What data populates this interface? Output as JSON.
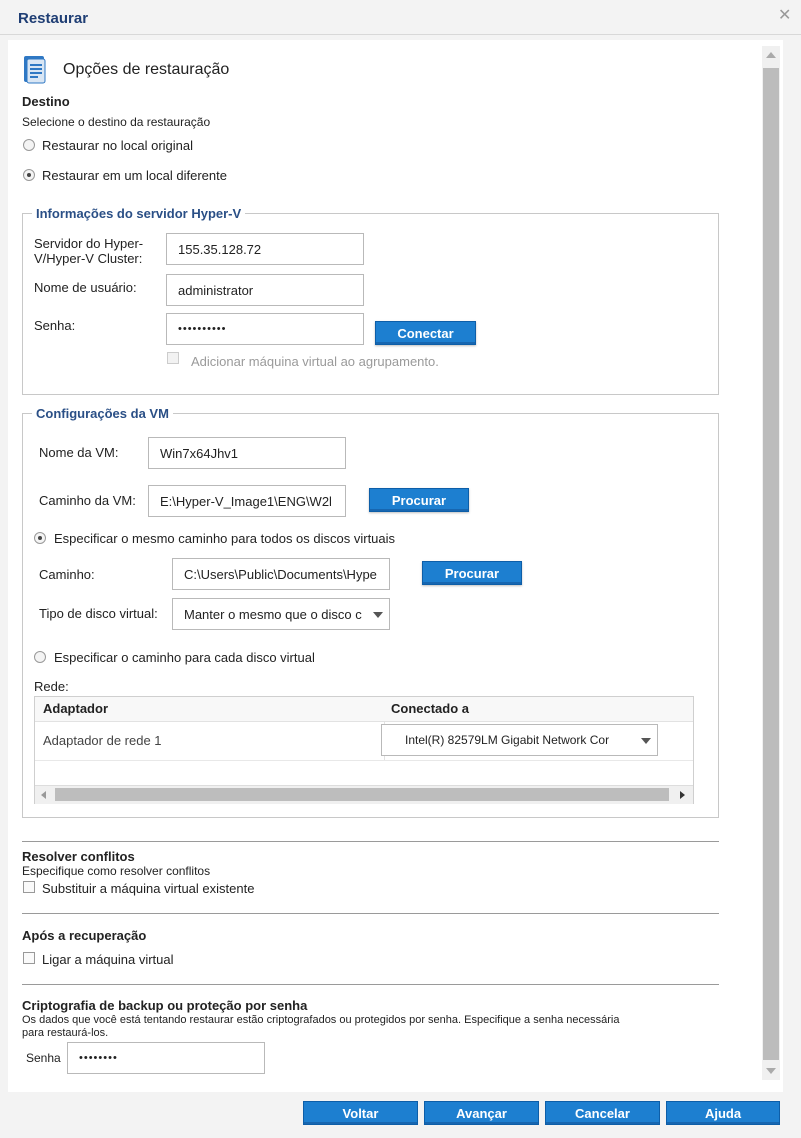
{
  "window": {
    "title": "Restaurar"
  },
  "header": {
    "title": "Opções de restauração"
  },
  "destination": {
    "heading": "Destino",
    "subtitle": "Selecione o destino da restauração",
    "option_original": "Restaurar no local original",
    "option_different": "Restaurar em um local diferente"
  },
  "hyperv": {
    "legend": "Informações do servidor Hyper-V",
    "server_label_line1": "Servidor do Hyper-",
    "server_label_line2": "V/Hyper-V Cluster:",
    "server_value": "155.35.128.72",
    "user_label": "Nome de usuário:",
    "user_value": "administrator",
    "password_label": "Senha:",
    "password_value": "••••••••••",
    "connect_label": "Conectar",
    "cluster_label": "Adicionar máquina virtual ao agrupamento."
  },
  "vm": {
    "legend": "Configurações da VM",
    "name_label": "Nome da VM:",
    "name_value": "Win7x64Jhv1",
    "path_label": "Caminho da VM:",
    "path_value": "E:\\Hyper-V_Image1\\ENG\\W2l",
    "browse_label": "Procurar",
    "same_path_option": "Especificar o mesmo caminho para todos os discos virtuais",
    "disk_path_label": "Caminho:",
    "disk_path_value": "C:\\Users\\Public\\Documents\\Hype",
    "disk_browse_label": "Procurar",
    "disk_type_label": "Tipo de disco virtual:",
    "disk_type_value": "Manter o mesmo que o disco c",
    "each_path_option": "Especificar o caminho para cada disco virtual",
    "network_label": "Rede:",
    "network_columns": [
      "Adaptador",
      "Conectado a"
    ],
    "network_rows": [
      {
        "adapter": "Adaptador de rede 1",
        "connected": "Intel(R) 82579LM Gigabit Network Cor"
      }
    ]
  },
  "conflicts": {
    "heading": "Resolver conflitos",
    "subtitle": "Especifique como resolver conflitos",
    "option": "Substituir a máquina virtual existente"
  },
  "after_recovery": {
    "heading": "Após a recuperação",
    "option": "Ligar a máquina virtual"
  },
  "encryption": {
    "heading": "Criptografia de backup ou proteção por senha",
    "description_line1": "Os dados que você está tentando restaurar estão criptografados ou protegidos por senha. Especifique a senha necessária",
    "description_line2": "para restaurá-los.",
    "password_label": "Senha",
    "password_value": "••••••••"
  },
  "footer": {
    "back": "Voltar",
    "next": "Avançar",
    "cancel": "Cancelar",
    "help": "Ajuda"
  },
  "colors": {
    "accent": "#1d7fd0",
    "legend": "#2a4f86",
    "title": "#1f3e74"
  }
}
